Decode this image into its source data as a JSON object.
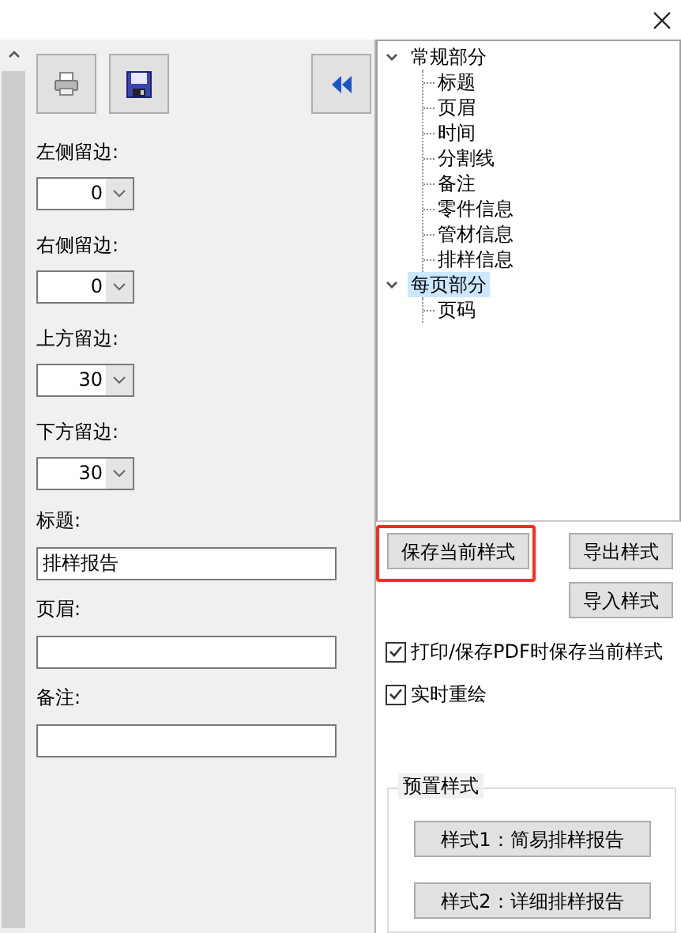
{
  "margins": [
    {
      "label": "左侧留边:",
      "value": "0"
    },
    {
      "label": "右侧留边:",
      "value": "0"
    },
    {
      "label": "上方留边:",
      "value": "30"
    },
    {
      "label": "下方留边:",
      "value": "30"
    }
  ],
  "text_fields": [
    {
      "label": "标题:",
      "value": "排样报告"
    },
    {
      "label": "页眉:"
    },
    {
      "label": "备注:"
    }
  ],
  "tree": [
    {
      "label": "常规部分",
      "expanded": true,
      "selected": false,
      "children": [
        {
          "label": "标题",
          "selected": false
        },
        {
          "label": "页眉",
          "selected": false
        },
        {
          "label": "时间",
          "selected": false
        },
        {
          "label": "分割线",
          "selected": false
        },
        {
          "label": "备注",
          "selected": false
        },
        {
          "label": "零件信息",
          "selected": false
        },
        {
          "label": "管材信息",
          "selected": false
        },
        {
          "label": "排样信息",
          "selected": false
        }
      ]
    },
    {
      "label": "每页部分",
      "expanded": true,
      "selected": true,
      "children": [
        {
          "label": "页码",
          "selected": false
        }
      ]
    }
  ],
  "style_buttons": [
    {
      "label": "保存当前样式",
      "highlighted": true
    },
    {
      "label": "导出样式",
      "highlighted": false
    },
    {
      "label": "导入样式",
      "highlighted": false
    }
  ],
  "options": [
    {
      "label": "打印/保存PDF时保存当前样式",
      "checked": true
    },
    {
      "label": "实时重绘",
      "checked": true
    }
  ],
  "presets": {
    "title": "预置样式",
    "buttons": [
      "样式1：简易排样报告",
      "样式2：详细排样报告"
    ]
  }
}
